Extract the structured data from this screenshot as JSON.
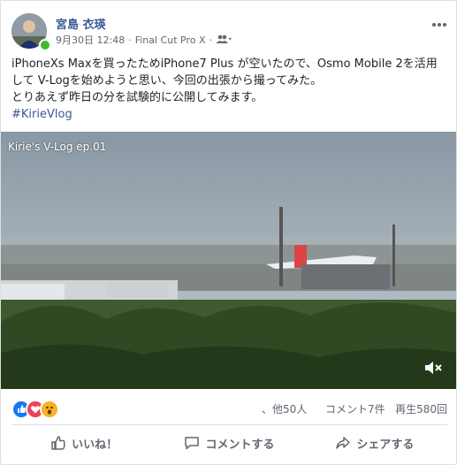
{
  "post": {
    "author": "宮島 衣瑛",
    "date": "9月30日 12:48",
    "separator1": "·",
    "app": "Final Cut Pro X",
    "separator2": "·",
    "more_icon": "ellipsis-icon",
    "text_line1": "iPhoneXs Maxを買ったためiPhone7 Plus が空いたので、Osmo Mobile 2を活用して V-Logを始めようと思い、今回の出張から撮ってみた。",
    "text_line2": "とりあえず昨日の分を試験的に公開してみます。",
    "hashtag": "#KirieVlog"
  },
  "video": {
    "title": "Kirie's V-Log ep.01",
    "mute_icon": "speaker-muted-icon"
  },
  "stats": {
    "reactions": [
      "like",
      "love",
      "wow"
    ],
    "others": "、他50人",
    "comments": "コメント7件",
    "views": "再生580回"
  },
  "actions": {
    "like": "いいね！",
    "comment": "コメントする",
    "share": "シェアする"
  },
  "colors": {
    "link": "#385898",
    "like_blue": "#1877f2",
    "love_red": "#f33e58",
    "wow_yellow": "#f7b125",
    "online_green": "#42b72a"
  }
}
